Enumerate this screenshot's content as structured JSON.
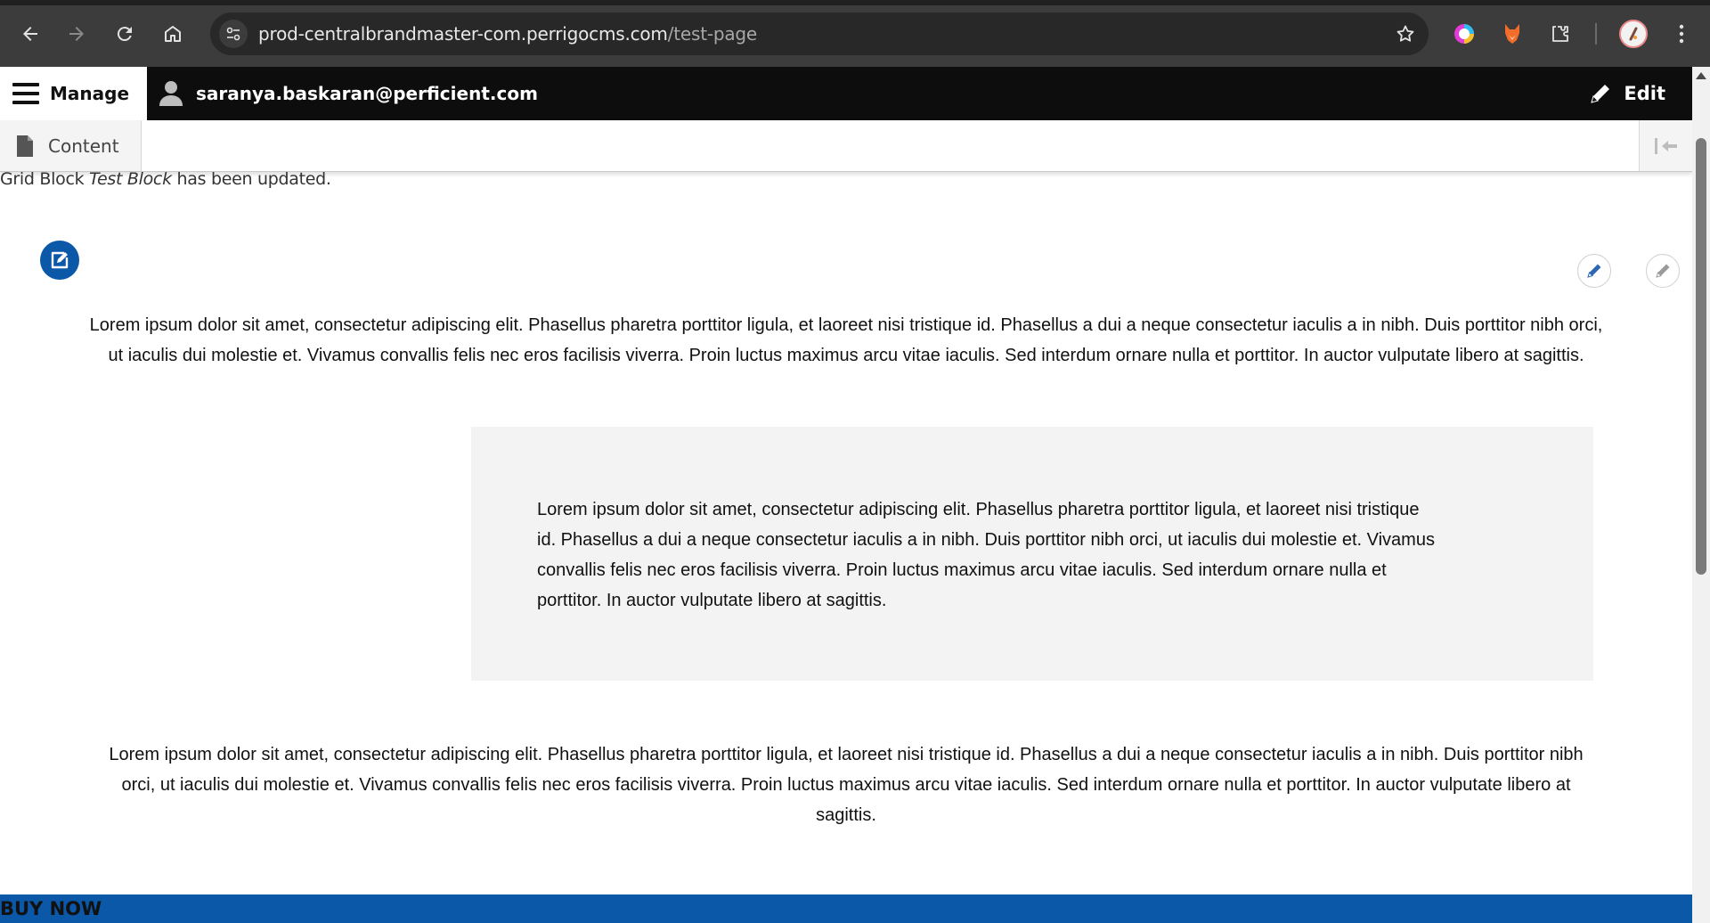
{
  "browser": {
    "url_host": "prod-centralbrandmaster-com.perrigocms.com",
    "url_path": "/test-page"
  },
  "admin_toolbar": {
    "manage_label": "Manage",
    "user_label": "saranya.baskaran@perficient.com",
    "edit_label": "Edit"
  },
  "tray": {
    "content_label": "Content"
  },
  "status": {
    "prefix": "Grid Block ",
    "block_name": "Test Block",
    "suffix": " has been updated."
  },
  "main": {
    "paragraph_1": "Lorem ipsum dolor sit amet, consectetur adipiscing elit. Phasellus pharetra porttitor ligula, et laoreet nisi tristique id. Phasellus a dui a neque consectetur iaculis a in nibh. Duis porttitor nibh orci, ut iaculis dui molestie et. Vivamus convallis felis nec eros facilisis viverra. Proin luctus maximus arcu vitae iaculis. Sed interdum ornare nulla et porttitor. In auctor vulputate libero at sagittis.",
    "paragraph_2": "Lorem ipsum dolor sit amet, consectetur adipiscing elit. Phasellus pharetra porttitor ligula, et laoreet nisi tristique id. Phasellus a dui a neque consectetur iaculis a in nibh. Duis porttitor nibh orci, ut iaculis dui molestie et. Vivamus convallis felis nec eros facilisis viverra. Proin luctus maximus arcu vitae iaculis. Sed interdum ornare nulla et porttitor. In auctor vulputate libero at sagittis.",
    "paragraph_3": "Lorem ipsum dolor sit amet, consectetur adipiscing elit. Phasellus pharetra porttitor ligula, et laoreet nisi tristique id. Phasellus a dui a neque consectetur iaculis a in nibh. Duis porttitor nibh orci, ut iaculis dui molestie et. Vivamus convallis felis nec eros facilisis viverra. Proin luctus maximus arcu vitae iaculis. Sed interdum ornare nulla et porttitor. In auctor vulputate libero at sagittis.",
    "buy_now_label": "BUY NOW"
  },
  "colors": {
    "accent_blue": "#0b57a8",
    "toolbar_black": "#0d0d0d",
    "box_gray": "#f3f3f3"
  },
  "icons": {
    "back": "arrow-left-icon",
    "forward": "arrow-right-icon",
    "reload": "reload-icon",
    "home": "home-icon",
    "site_info": "tune-icon",
    "bookmark": "star-icon",
    "extension_color": "color-picker-icon",
    "extension_fox": "fox-icon",
    "extensions": "puzzle-icon",
    "profile": "avatar",
    "menu": "kebab-menu-icon",
    "manage": "hamburger-icon",
    "user": "person-icon",
    "edit": "pencil-icon",
    "content": "document-icon",
    "collapse": "collapse-icon"
  }
}
